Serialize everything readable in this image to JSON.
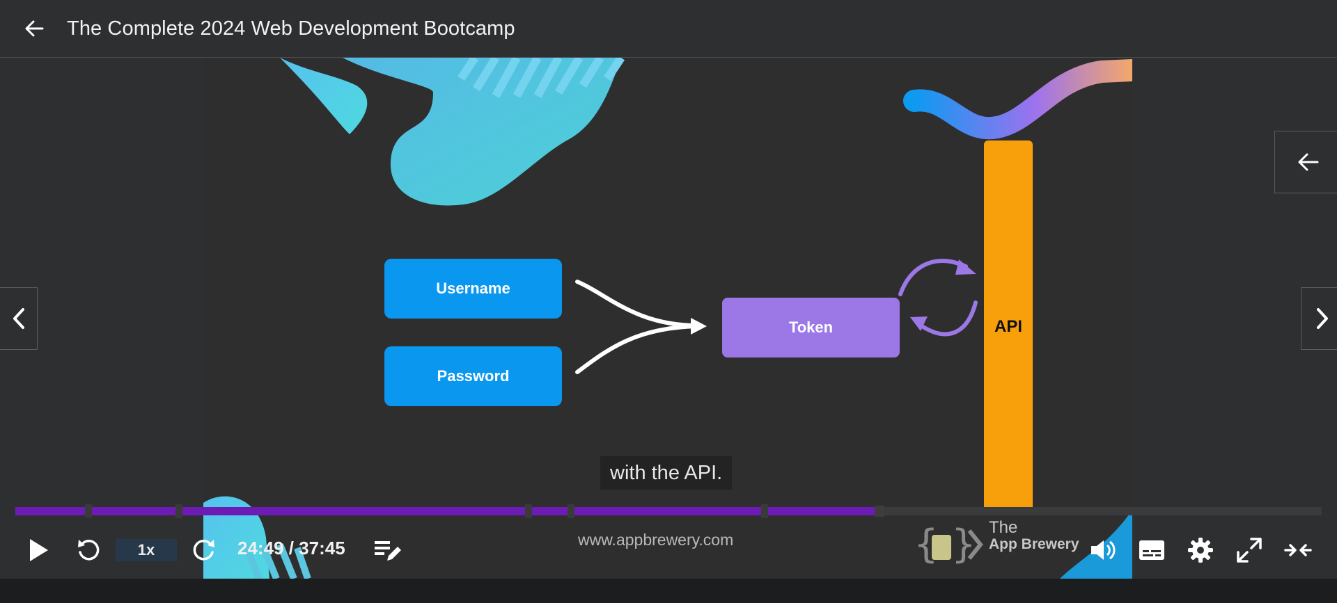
{
  "header": {
    "back_icon": "arrow-left-icon",
    "title": "The Complete 2024 Web Development Bootcamp"
  },
  "video": {
    "diagram": {
      "username_label": "Username",
      "password_label": "Password",
      "token_label": "Token",
      "api_label": "API"
    },
    "caption": "with the API.",
    "watermark_url": "www.appbrewery.com",
    "brand_line1": "The",
    "brand_line2": "App Brewery"
  },
  "player": {
    "progress_fraction": 0.66,
    "speed_label": "1x",
    "time_display": "24:49 / 37:45",
    "icons": {
      "play": "play-icon",
      "rewind": "rewind-5-icon",
      "forward": "forward-5-icon",
      "notes": "add-note-icon",
      "volume": "volume-icon",
      "captions": "captions-icon",
      "settings": "gear-icon",
      "fullscreen": "expand-icon",
      "exit_theater": "collapse-icon"
    }
  },
  "side_nav": {
    "prev_icon": "chevron-left-icon",
    "next_icon": "chevron-right-icon",
    "panel_icon": "arrow-left-icon"
  },
  "colors": {
    "progress": "#6d1bb5",
    "box_blue": "#0a97f0",
    "box_purple": "#9c77e6",
    "api_orange": "#f7a00c"
  }
}
